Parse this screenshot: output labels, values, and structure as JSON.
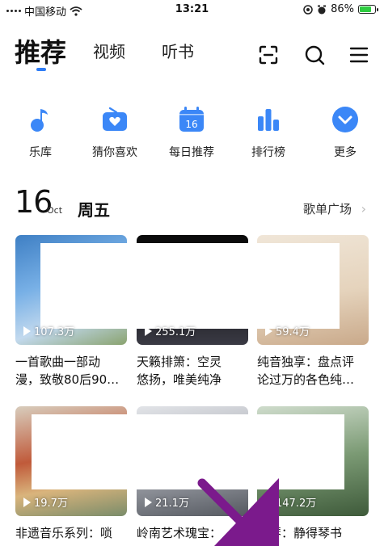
{
  "status_bar": {
    "carrier": "中国移动",
    "time": "13:21",
    "battery_pct": "86%",
    "battery_level": 0.86
  },
  "top_nav": {
    "tabs": [
      {
        "label": "推荐",
        "active": true
      },
      {
        "label": "视频",
        "active": false
      },
      {
        "label": "听书",
        "active": false
      }
    ],
    "icons": [
      "scan-icon",
      "search-icon",
      "menu-icon"
    ]
  },
  "shortcuts": [
    {
      "label": "乐库",
      "icon": "music-note-icon"
    },
    {
      "label": "猜你喜欢",
      "icon": "radio-heart-icon"
    },
    {
      "label": "每日推荐",
      "icon": "calendar-icon",
      "badge": "16"
    },
    {
      "label": "排行榜",
      "icon": "bar-chart-icon"
    },
    {
      "label": "更多",
      "icon": "chevron-down-circle-icon"
    }
  ],
  "date_row": {
    "day": "16",
    "month": "Oct",
    "weekday": "周五",
    "link": "歌单广场",
    "chevron": "›"
  },
  "cards": [
    {
      "plays": "107.3万",
      "title_lines": [
        "一首歌曲一部动",
        "漫，致敬80后90…"
      ]
    },
    {
      "plays": "255.1万",
      "title_lines": [
        "天籁排箫：空灵",
        "悠扬，唯美纯净"
      ]
    },
    {
      "plays": "59.4万",
      "title_lines": [
        "纯音独享：盘点评",
        "论过万的各色纯…"
      ]
    },
    {
      "plays": "19.7万",
      "title_lines": [
        "非遗音乐系列：唢",
        ""
      ]
    },
    {
      "plays": "21.1万",
      "title_lines": [
        "岭南艺术瑰宝：",
        ""
      ]
    },
    {
      "plays": "147.2万",
      "title_lines": [
        "古琴：静得琴书",
        ""
      ]
    }
  ],
  "colors": {
    "accent": "#2f7df6",
    "overlay_arrow": "#7b1a8c"
  }
}
